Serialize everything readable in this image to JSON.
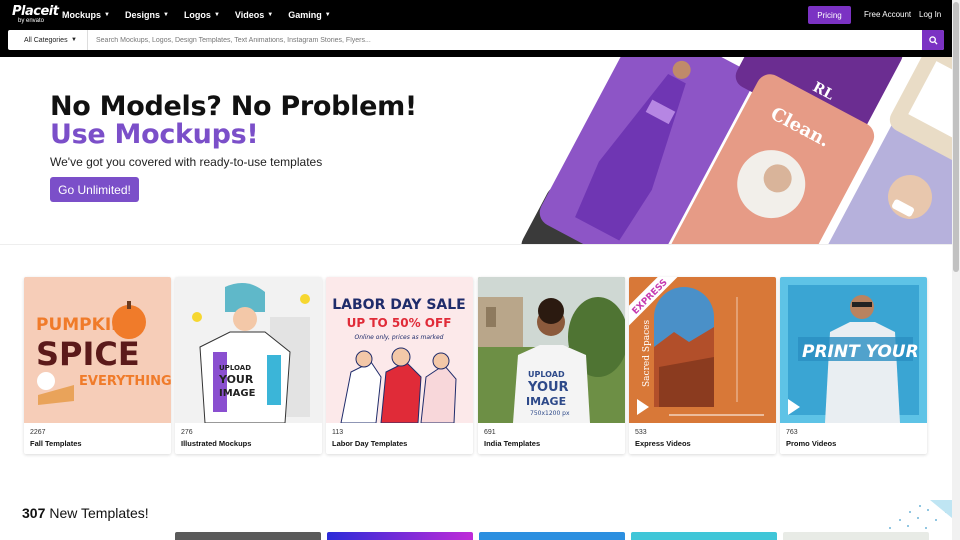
{
  "nav": {
    "logo_text": "Placeit",
    "logo_sub": "by envato",
    "menu": [
      {
        "label": "Mockups"
      },
      {
        "label": "Designs"
      },
      {
        "label": "Logos"
      },
      {
        "label": "Videos"
      },
      {
        "label": "Gaming"
      }
    ],
    "pricing_label": "Pricing",
    "free_account_label": "Free Account",
    "login_label": "Log In"
  },
  "search": {
    "category": "All Categories",
    "placeholder": "Search Mockups, Logos, Design Templates, Text Animations, Instagram Stories, Flyers..."
  },
  "hero": {
    "headline": "No Models? No Problem!",
    "headline_accent": "Use Mockups!",
    "subtitle": "We've got you covered with ready-to-use templates",
    "cta_label": "Go Unlimited!",
    "art_texts": {
      "clean": "Clean.",
      "t1": "RL"
    }
  },
  "categories": [
    {
      "count": "2267",
      "name": "Fall Templates",
      "art": "PUMPKIN SPICE EVERYTHING!"
    },
    {
      "count": "276",
      "name": "Illustrated Mockups",
      "art": "UPLOAD YOUR IMAGE"
    },
    {
      "count": "113",
      "name": "Labor Day Templates",
      "art": "LABOR DAY SALE",
      "art2": "UP TO 50% OFF",
      "art3": "Online only, prices as marked"
    },
    {
      "count": "691",
      "name": "India Templates",
      "art": "UPLOAD YOUR IMAGE",
      "art2": "750x1200 px"
    },
    {
      "count": "533",
      "name": "Express Videos",
      "art": "EXPRESS",
      "art2": "Sacred Spaces"
    },
    {
      "count": "763",
      "name": "Promo Videos",
      "art": "PRINT YOUR"
    }
  ],
  "new_templates": {
    "count": "307",
    "label": "New Templates!"
  },
  "colors": {
    "brand": "#7b32c3",
    "accent": "#7b4fc9"
  }
}
